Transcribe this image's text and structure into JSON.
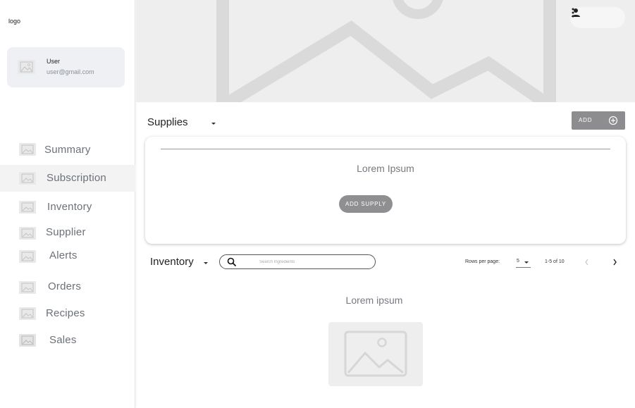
{
  "sidebar": {
    "logo": "logo",
    "user": {
      "name": "User",
      "email": "user@gmail.com"
    },
    "items": [
      {
        "label": "Summary",
        "icon": "image-icon",
        "active": false
      },
      {
        "label": "Subscription",
        "icon": "image-icon",
        "active": true
      },
      {
        "label": "Inventory",
        "icon": "image-icon",
        "active": false
      },
      {
        "label": "Supplier",
        "icon": "image-icon",
        "active": false
      },
      {
        "label": "Alerts",
        "icon": "image-icon",
        "active": false
      },
      {
        "label": "Orders",
        "icon": "image-icon",
        "active": false
      },
      {
        "label": "Recipes",
        "icon": "image-icon",
        "active": false
      },
      {
        "label": "Sales",
        "icon": "image-icon",
        "active": false
      }
    ]
  },
  "header": {
    "icons": [
      "person-icon",
      "more-vertical-icon"
    ]
  },
  "supplies": {
    "title": "Supplies",
    "add_label": "ADD",
    "card_text": "Lorem Ipsum",
    "add_supply_label": "ADD SUPPLY"
  },
  "inventory": {
    "title": "Inventory",
    "search_placeholder": "Search Ingredients",
    "rows_per_page_label": "Rows per page:",
    "rows_per_page_value": "5",
    "range_label": "1-5 of 10",
    "empty_text": "Lorem ipsum"
  },
  "colors": {
    "accent_button": "#8d8d8f",
    "placeholder_bg": "#eeeeee",
    "active_nav_bg": "#f3f3f4"
  }
}
